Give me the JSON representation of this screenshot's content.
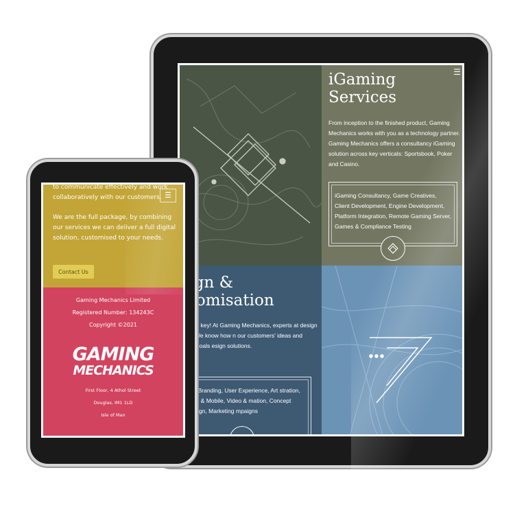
{
  "tablet": {
    "igaming": {
      "title": "iGaming Services",
      "body": "From inception to the finished product, Gaming Mechanics works with you as a technology partner. Gaming Mechanics offers a consultancy iGaming solution across key verticals: Sportsbook, Poker and Casino.",
      "services": "iGaming Consultancy, Game Creatives, Client Development, Engine Development, Platform Integration, Remote Gaming Server, Games & Compliance Testing"
    },
    "design": {
      "title": "esign & ustomisation",
      "body": "misation is key! At Gaming Mechanics, experts at design thinking. We know how n our customers' ideas and business goals esign solutions.",
      "services": "line Branding, User Experience, Art stration, Web & Mobile, Video & mation, Concept Design, Marketing mpaigns"
    },
    "menu_icon": "hamburger-icon"
  },
  "phone": {
    "top_text_1": "to communicate effectively and work collaboratively with our customers.",
    "top_text_2": "We are the full package, by combining our services we can deliver a full digital solution, customised to your needs.",
    "contact_button": "Contact Us",
    "company": "Gaming Mechanics Limited",
    "registered": "Registered Number: 134243C",
    "copyright": "Copyright ©2021",
    "logo_line1": "GAMING",
    "logo_line2": "MECHANICS",
    "address1": "First Floor, 4 Athol Street",
    "address2": "Douglas, IM1 1LD",
    "address3": "Isle of Man",
    "menu_icon": "hamburger-icon"
  },
  "colors": {
    "olive": "#737761",
    "dark_green": "#4a5545",
    "navy_blue": "#3e5a73",
    "sky_blue": "#6a93b6",
    "mustard": "#c2a536",
    "pink": "#d2435f"
  }
}
